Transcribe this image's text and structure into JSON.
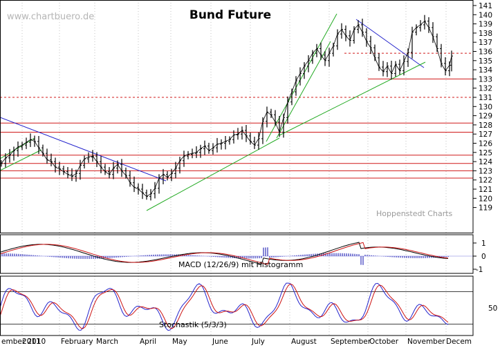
{
  "watermark": "www.chartbuero.de",
  "credit": "Hoppenstedt Charts",
  "chart_data": [
    {
      "type": "line",
      "title": "Bund Future",
      "x_axis": {
        "labels": [
          "ember 2010",
          "2011",
          "February",
          "March",
          "April",
          "May",
          "June",
          "July",
          "August",
          "September",
          "October",
          "November",
          "Decem"
        ]
      },
      "y_axis": {
        "ticks": [
          "141",
          "140",
          "139",
          "138",
          "137",
          "136",
          "135",
          "134",
          "133",
          "132",
          "131",
          "130",
          "129",
          "128",
          "127",
          "126",
          "125",
          "124",
          "123",
          "122",
          "121",
          "120",
          "119"
        ]
      },
      "ylim": [
        119,
        141.5
      ],
      "series": [
        {
          "values": [
            [
              0,
              123.8
            ],
            [
              6,
              124.4
            ],
            [
              12,
              124.7
            ],
            [
              18,
              125.2
            ],
            [
              24,
              125.6
            ],
            [
              30,
              125.8
            ],
            [
              36,
              126.1
            ],
            [
              42,
              126.4
            ],
            [
              48,
              126.2
            ],
            [
              54,
              125.5
            ],
            [
              60,
              124.9
            ],
            [
              66,
              124.2
            ],
            [
              72,
              124.0
            ],
            [
              78,
              123.4
            ],
            [
              84,
              123.2
            ],
            [
              90,
              122.9
            ],
            [
              96,
              122.6
            ],
            [
              102,
              122.4
            ],
            [
              108,
              122.7
            ],
            [
              114,
              123.6
            ],
            [
              120,
              124.3
            ],
            [
              126,
              124.5
            ],
            [
              132,
              124.6
            ],
            [
              138,
              124.0
            ],
            [
              144,
              123.4
            ],
            [
              150,
              122.9
            ],
            [
              156,
              122.6
            ],
            [
              162,
              123.3
            ],
            [
              168,
              123.7
            ],
            [
              174,
              123.0
            ],
            [
              180,
              122.5
            ],
            [
              186,
              121.7
            ],
            [
              192,
              121.2
            ],
            [
              198,
              121.0
            ],
            [
              204,
              120.6
            ],
            [
              210,
              120.2
            ],
            [
              216,
              120.5
            ],
            [
              222,
              121.1
            ],
            [
              228,
              122.2
            ],
            [
              234,
              122.6
            ],
            [
              240,
              122.3
            ],
            [
              246,
              122.7
            ],
            [
              252,
              123.3
            ],
            [
              258,
              124.1
            ],
            [
              264,
              124.6
            ],
            [
              270,
              124.8
            ],
            [
              276,
              124.9
            ],
            [
              282,
              125.0
            ],
            [
              288,
              125.4
            ],
            [
              294,
              125.7
            ],
            [
              300,
              125.2
            ],
            [
              306,
              125.5
            ],
            [
              312,
              125.9
            ],
            [
              318,
              126.0
            ],
            [
              324,
              126.2
            ],
            [
              330,
              126.4
            ],
            [
              336,
              126.9
            ],
            [
              342,
              127.0
            ],
            [
              348,
              127.4
            ],
            [
              354,
              126.8
            ],
            [
              360,
              126.2
            ],
            [
              366,
              125.8
            ],
            [
              372,
              126.5
            ],
            [
              378,
              128.4
            ],
            [
              384,
              129.4
            ],
            [
              390,
              129.1
            ],
            [
              396,
              128.3
            ],
            [
              402,
              127.2
            ],
            [
              408,
              128.8
            ],
            [
              414,
              130.5
            ],
            [
              420,
              131.6
            ],
            [
              426,
              132.8
            ],
            [
              432,
              133.6
            ],
            [
              438,
              134.4
            ],
            [
              444,
              135.0
            ],
            [
              450,
              135.8
            ],
            [
              456,
              136.3
            ],
            [
              462,
              135.6
            ],
            [
              468,
              135.0
            ],
            [
              474,
              135.8
            ],
            [
              480,
              136.6
            ],
            [
              486,
              137.9
            ],
            [
              492,
              138.4
            ],
            [
              498,
              137.7
            ],
            [
              504,
              137.2
            ],
            [
              510,
              138.4
            ],
            [
              516,
              138.9
            ],
            [
              522,
              138.1
            ],
            [
              528,
              137.1
            ],
            [
              534,
              136.4
            ],
            [
              540,
              135.3
            ],
            [
              546,
              134.3
            ],
            [
              552,
              133.8
            ],
            [
              558,
              134.4
            ],
            [
              564,
              133.6
            ],
            [
              570,
              134.6
            ],
            [
              576,
              133.9
            ],
            [
              582,
              134.9
            ],
            [
              588,
              135.9
            ],
            [
              594,
              138.1
            ],
            [
              600,
              138.6
            ],
            [
              606,
              138.9
            ],
            [
              612,
              139.3
            ],
            [
              618,
              138.6
            ],
            [
              624,
              137.6
            ],
            [
              630,
              136.3
            ],
            [
              636,
              134.7
            ],
            [
              642,
              133.9
            ],
            [
              648,
              134.5
            ],
            [
              651,
              135.5
            ]
          ]
        }
      ],
      "levels_solid": [
        128.2,
        127.2,
        124.7,
        123.8,
        123.0,
        122.2,
        133.0
      ],
      "levels_dashed": [
        131.0,
        135.8
      ]
    },
    {
      "type": "line",
      "title": "MACD (12/26/9) mit Histogramm",
      "y_axis": {
        "ticks": [
          "1",
          "0",
          "-1"
        ]
      },
      "ylim": [
        -1.6,
        1.6
      ]
    },
    {
      "type": "line",
      "title": "Stochastik (5/3/3)",
      "y_axis": {
        "ticks": [
          "50"
        ]
      },
      "ylim": [
        0,
        100
      ],
      "levels": [
        80,
        20
      ]
    }
  ]
}
